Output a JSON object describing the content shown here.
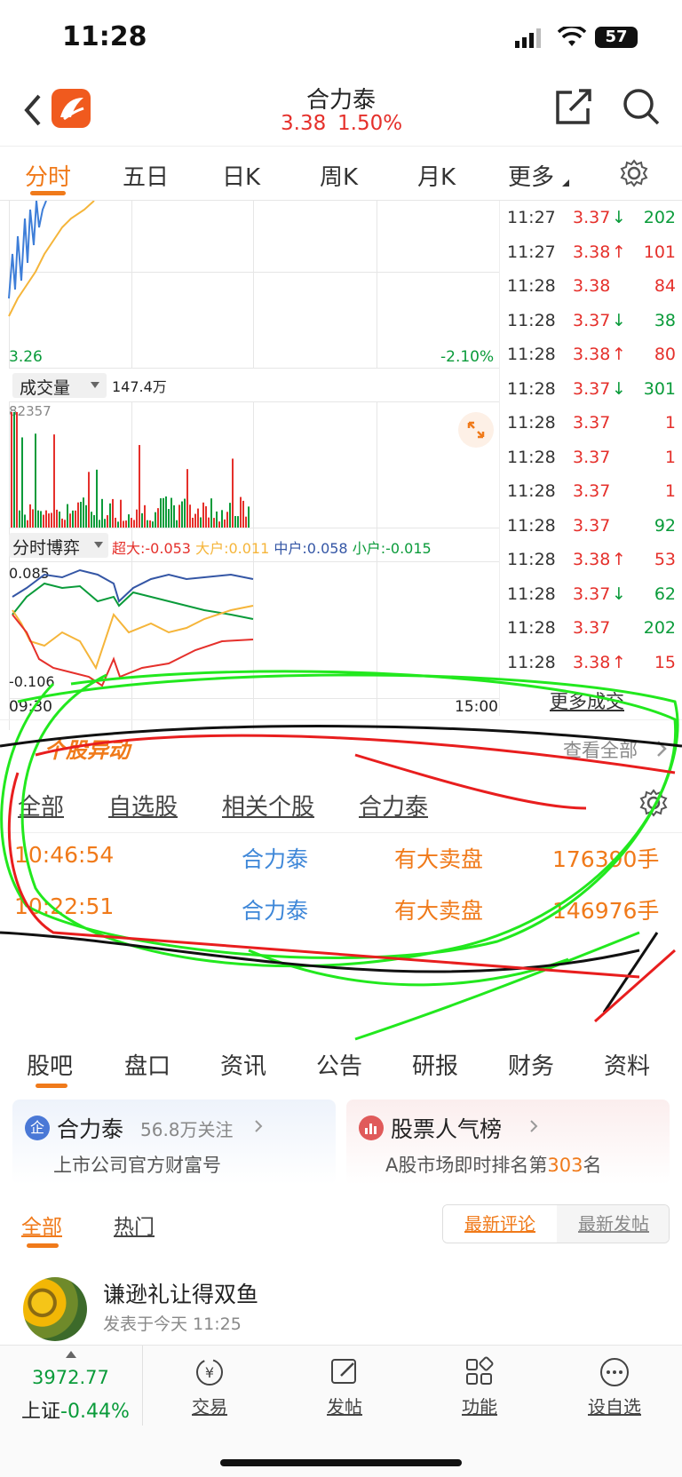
{
  "status_bar": {
    "time": "11:28",
    "battery": "57"
  },
  "header": {
    "title": "合力泰",
    "price": "3.38",
    "change_pct": "1.50%"
  },
  "tabs": [
    {
      "label": "分时"
    },
    {
      "label": "五日"
    },
    {
      "label": "日K"
    },
    {
      "label": "周K"
    },
    {
      "label": "月K"
    },
    {
      "label": "更多"
    }
  ],
  "chart": {
    "low_price": "3.26",
    "low_pct": "-2.10%",
    "volume_label": "成交量",
    "volume_total": "147.4万",
    "volume_max": "82357",
    "bo_yi_label": "分时博弈",
    "bo_yi": [
      {
        "label": "超大:",
        "value": "-0.053",
        "color": "#e5302b"
      },
      {
        "label": "大户:",
        "value": "0.011",
        "color": "#f5b53a"
      },
      {
        "label": "中户:",
        "value": "0.058",
        "color": "#3456a5"
      },
      {
        "label": "小户:",
        "value": "-0.015",
        "color": "#0a9b3a"
      }
    ],
    "bo_yi_high": "0.085",
    "bo_yi_low": "-0.106",
    "time_start": "09:30",
    "time_end": "15:00"
  },
  "ticks": [
    {
      "time": "11:27",
      "price": "3.37",
      "dir": "↓",
      "vol": "202",
      "vc": "green"
    },
    {
      "time": "11:27",
      "price": "3.38",
      "dir": "↑",
      "vol": "101",
      "vc": "red"
    },
    {
      "time": "11:28",
      "price": "3.38",
      "dir": "",
      "vol": "84",
      "vc": "red"
    },
    {
      "time": "11:28",
      "price": "3.37",
      "dir": "↓",
      "vol": "38",
      "vc": "green"
    },
    {
      "time": "11:28",
      "price": "3.38",
      "dir": "↑",
      "vol": "80",
      "vc": "red"
    },
    {
      "time": "11:28",
      "price": "3.37",
      "dir": "↓",
      "vol": "301",
      "vc": "green"
    },
    {
      "time": "11:28",
      "price": "3.37",
      "dir": "",
      "vol": "1",
      "vc": "red"
    },
    {
      "time": "11:28",
      "price": "3.37",
      "dir": "",
      "vol": "1",
      "vc": "red"
    },
    {
      "time": "11:28",
      "price": "3.37",
      "dir": "",
      "vol": "1",
      "vc": "red"
    },
    {
      "time": "11:28",
      "price": "3.37",
      "dir": "",
      "vol": "92",
      "vc": "green"
    },
    {
      "time": "11:28",
      "price": "3.38",
      "dir": "↑",
      "vol": "53",
      "vc": "red"
    },
    {
      "time": "11:28",
      "price": "3.37",
      "dir": "↓",
      "vol": "62",
      "vc": "green"
    },
    {
      "time": "11:28",
      "price": "3.37",
      "dir": "",
      "vol": "202",
      "vc": "green"
    },
    {
      "time": "11:28",
      "price": "3.38",
      "dir": "↑",
      "vol": "15",
      "vc": "red"
    }
  ],
  "more_trades": "更多成交",
  "stock_moves": {
    "title": "个股异动",
    "view_all": "查看全部",
    "subtabs": [
      "全部",
      "自选股",
      "相关个股",
      "合力泰"
    ],
    "active_subtab": 3,
    "rows": [
      {
        "time": "10:46:54",
        "name": "合力泰",
        "event": "有大卖盘",
        "amount": "176390手"
      },
      {
        "time": "10:22:51",
        "name": "合力泰",
        "event": "有大卖盘",
        "amount": "146976手"
      }
    ]
  },
  "section_tabs": [
    "股吧",
    "盘口",
    "资讯",
    "公告",
    "研报",
    "财务",
    "资料"
  ],
  "company_card": {
    "badge": "企",
    "name": "合力泰",
    "followers": "56.8万关注",
    "desc": "上市公司官方财富号"
  },
  "popularity_card": {
    "title": "股票人气榜",
    "desc_prefix": "A股市场即时排名第",
    "rank": "303",
    "desc_suffix": "名"
  },
  "post_filter": {
    "tabs": [
      "全部",
      "热门"
    ],
    "sort": [
      "最新评论",
      "最新发帖"
    ]
  },
  "post": {
    "author": "谦逊礼让得双鱼",
    "time": "发表于今天 11:25"
  },
  "bottom_bar": {
    "index_value": "3972.77",
    "index_name": "上证",
    "index_change": "-0.44%",
    "items": [
      {
        "label": "交易",
        "icon": "trade-icon"
      },
      {
        "label": "发帖",
        "icon": "post-icon"
      },
      {
        "label": "功能",
        "icon": "grid-icon"
      },
      {
        "label": "设自选",
        "icon": "more-icon"
      }
    ]
  }
}
